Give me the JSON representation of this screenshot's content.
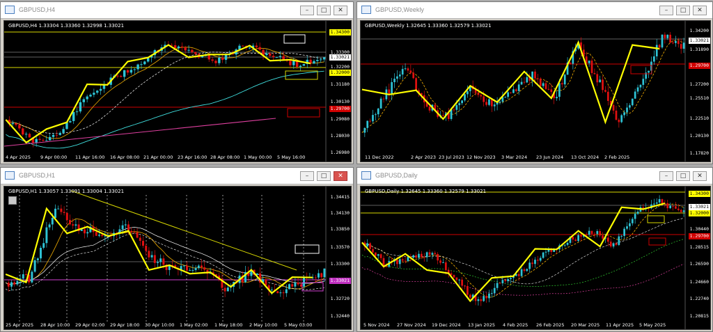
{
  "windows": [
    {
      "key": "h4",
      "title": "GBPUSD,H4",
      "active_close": false,
      "info": "GBPUSD,H4  1.33304  1.33360  1.32998  1.33021",
      "price_labels": [
        {
          "text": "1.34300",
          "style": "yellow"
        },
        {
          "text": "1.33300",
          "style": "plain"
        },
        {
          "text": "1.33021",
          "style": "white"
        },
        {
          "text": "1.32200",
          "style": "plain"
        },
        {
          "text": "1.32000",
          "style": "yellow"
        },
        {
          "text": "1.31180",
          "style": "plain"
        },
        {
          "text": "1.30130",
          "style": "plain"
        },
        {
          "text": "1.29700",
          "style": "red"
        },
        {
          "text": "1.29080",
          "style": "plain"
        },
        {
          "text": "1.28030",
          "style": "plain"
        },
        {
          "text": "1.26980",
          "style": "plain"
        }
      ],
      "time_labels": [
        "4 Apr 2025",
        "9 Apr 00:00",
        "11 Apr 16:00",
        "16 Apr 08:00",
        "21 Apr 00:00",
        "23 Apr 16:00",
        "28 Apr 08:00",
        "1 May 00:00",
        "5 May 16:00"
      ]
    },
    {
      "key": "weekly",
      "title": "GBPUSD,Weekly",
      "active_close": false,
      "info": "GBPUSD,Weekly  1.32645  1.33360  1.32579  1.33021",
      "price_labels": [
        {
          "text": "1.34200",
          "style": "plain"
        },
        {
          "text": "1.33021",
          "style": "white"
        },
        {
          "text": "1.31890",
          "style": "plain"
        },
        {
          "text": "1.29700",
          "style": "red"
        },
        {
          "text": "1.27200",
          "style": "plain"
        },
        {
          "text": "1.25510",
          "style": "plain"
        },
        {
          "text": "1.22510",
          "style": "plain"
        },
        {
          "text": "1.20130",
          "style": "plain"
        },
        {
          "text": "1.17820",
          "style": "plain"
        }
      ],
      "time_labels": [
        "11 Dec 2022",
        "2 Apr 2023",
        "23 Jul 2023",
        "12 Nov 2023",
        "3 Mar 2024",
        "23 Jun 2024",
        "13 Oct 2024",
        "2 Feb 2025"
      ]
    },
    {
      "key": "h1",
      "title": "GBPUSD,H1",
      "active_close": true,
      "info": "GBPUSD,H1  1.33057  1.33091  1.33004  1.33021",
      "price_labels": [
        {
          "text": "1.34415",
          "style": "plain"
        },
        {
          "text": "1.34130",
          "style": "plain"
        },
        {
          "text": "1.33850",
          "style": "plain"
        },
        {
          "text": "1.33570",
          "style": "plain"
        },
        {
          "text": "1.33300",
          "style": "plain"
        },
        {
          "text": "1.33021",
          "style": "magenta"
        },
        {
          "text": "1.32720",
          "style": "plain"
        },
        {
          "text": "1.32440",
          "style": "plain"
        }
      ],
      "time_labels": [
        "25 Apr 2025",
        "28 Apr 10:00",
        "29 Apr 02:00",
        "29 Apr 18:00",
        "30 Apr 10:00",
        "1 May 02:00",
        "1 May 18:00",
        "2 May 10:00",
        "5 May 03:00"
      ]
    },
    {
      "key": "daily",
      "title": "GBPUSD,Daily",
      "active_close": false,
      "info": "GBPUSD,Daily  1.32645  1.33360  1.32579  1.33021",
      "price_labels": [
        {
          "text": "1.34300",
          "style": "yellow"
        },
        {
          "text": "1.33021",
          "style": "white"
        },
        {
          "text": "1.32000",
          "style": "yellow"
        },
        {
          "text": "1.30440",
          "style": "plain"
        },
        {
          "text": "1.29700",
          "style": "red"
        },
        {
          "text": "1.28515",
          "style": "plain"
        },
        {
          "text": "1.26590",
          "style": "plain"
        },
        {
          "text": "1.24660",
          "style": "plain"
        },
        {
          "text": "1.22740",
          "style": "plain"
        },
        {
          "text": "1.20815",
          "style": "plain"
        }
      ],
      "time_labels": [
        "5 Nov 2024",
        "27 Nov 2024",
        "19 Dec 2024",
        "13 Jan 2025",
        "4 Feb 2025",
        "26 Feb 2025",
        "20 Mar 2025",
        "11 Apr 2025",
        "5 May 2025"
      ]
    }
  ],
  "window_buttons": {
    "minimize": "–",
    "maximize": "□",
    "close": "✕"
  },
  "colors": {
    "bull": "#2ec4d6",
    "bear": "#e01010",
    "zigzag": "#ffff00",
    "ma_fast": "#e0a000",
    "ma_slow": "#ffffff",
    "ma_cyan": "#40e0e0",
    "ma_magenta": "#e040a0",
    "level_yellow": "#d8d800",
    "level_red": "#d00000",
    "level_magenta": "#d040d0"
  }
}
